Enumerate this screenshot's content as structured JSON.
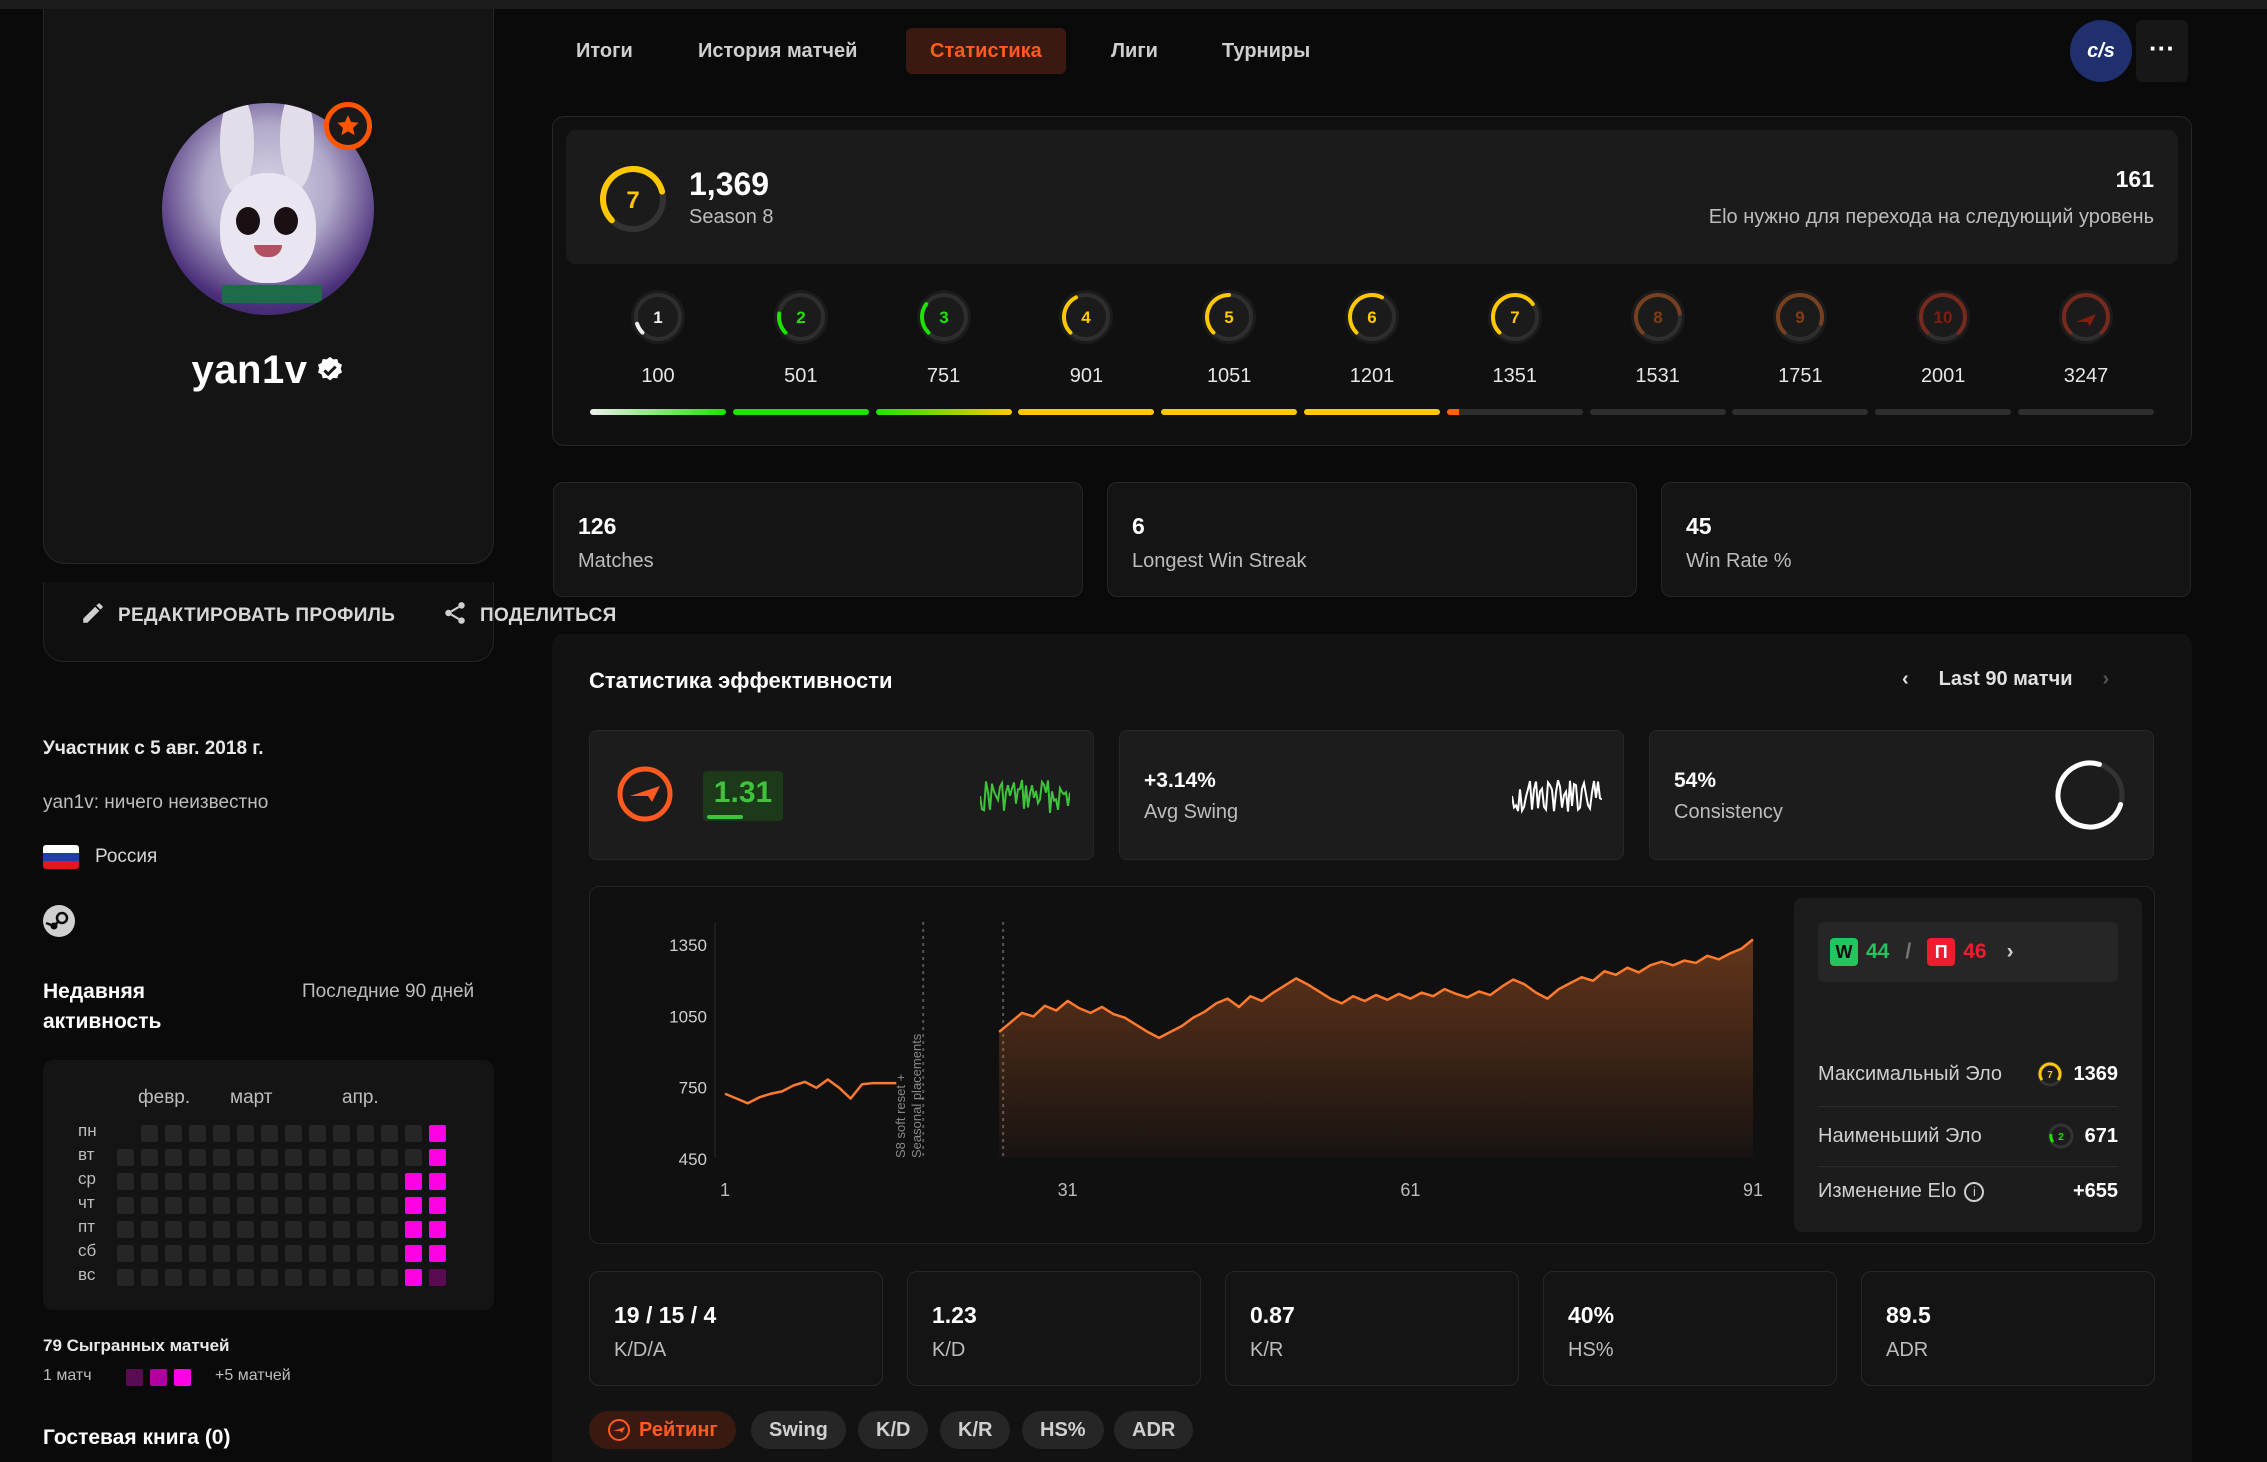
{
  "nav": {
    "tabs": [
      "Итоги",
      "История матчей",
      "Статистика",
      "Лиги",
      "Турниры"
    ],
    "active_tab": "Статистика",
    "game_logo": "cs",
    "more_label": "···"
  },
  "profile": {
    "username": "yan1v",
    "verified": true,
    "edit_label": "РЕДАКТИРОВАТЬ ПРОФИЛЬ",
    "share_label": "ПОДЕЛИТЬСЯ",
    "member_since": "Участник с 5 авг. 2018 г.",
    "bio": "yan1v: ничего неизвестно",
    "country": "Россия"
  },
  "activity": {
    "title": "Недавняя активность",
    "range": "Последние 90 дней",
    "months": [
      "февр.",
      "март",
      "апр."
    ],
    "days": [
      "пн",
      "вт",
      "ср",
      "чт",
      "пт",
      "сб",
      "вс"
    ],
    "active_cells": [
      [
        13,
        0
      ],
      [
        13,
        1
      ],
      [
        12,
        2
      ],
      [
        13,
        2
      ],
      [
        12,
        3
      ],
      [
        13,
        3
      ],
      [
        12,
        4
      ],
      [
        13,
        4
      ],
      [
        12,
        5
      ],
      [
        13,
        5
      ],
      [
        12,
        6
      ]
    ],
    "faint_cells": [
      [
        13,
        6
      ]
    ],
    "played_label": "79 Сыгранных матчей",
    "legend_low": "1 матч",
    "legend_high": "+5 матчей"
  },
  "guestbook": "Гостевая книга (0)",
  "elo": {
    "level": "7",
    "value": "1,369",
    "season": "Season 8",
    "to_next": "161",
    "to_next_label": "Elo нужно для перехода на следующий уровень",
    "progress_in_level": 0.09,
    "levels": [
      {
        "level": "1",
        "min": "100",
        "color": "#eeeeee"
      },
      {
        "level": "2",
        "min": "501",
        "color": "#1ce400"
      },
      {
        "level": "3",
        "min": "751",
        "color": "#1ce400"
      },
      {
        "level": "4",
        "min": "901",
        "color": "#ffc800"
      },
      {
        "level": "5",
        "min": "1051",
        "color": "#ffc800"
      },
      {
        "level": "6",
        "min": "1201",
        "color": "#ffc800"
      },
      {
        "level": "7",
        "min": "1351",
        "color": "#ffc800"
      },
      {
        "level": "8",
        "min": "1531",
        "color": "#ff6309"
      },
      {
        "level": "9",
        "min": "1751",
        "color": "#ff6309"
      },
      {
        "level": "10",
        "min": "2001",
        "color": "#fe1f00"
      },
      {
        "level": "",
        "min": "3247",
        "color": "#fe1f00"
      }
    ]
  },
  "stats": [
    {
      "value": "126",
      "label": "Matches"
    },
    {
      "value": "6",
      "label": "Longest Win Streak"
    },
    {
      "value": "45",
      "label": "Win Rate %"
    }
  ],
  "performance": {
    "title": "Статистика эффективности",
    "range": "Last 90 матчи",
    "rating": "1.31",
    "rating_fill": 0.5,
    "avg_swing": "+3.14%",
    "avg_swing_label": "Avg Swing",
    "consistency": "54%",
    "consistency_label": "Consistency",
    "consistency_fraction": 0.54,
    "wins": "44",
    "losses": "46",
    "win_letter": "W",
    "loss_letter": "П",
    "max_elo_label": "Максимальный Эло",
    "max_elo_level": "7",
    "max_elo": "1369",
    "min_elo_label": "Наименьший Эло",
    "min_elo_level": "2",
    "min_elo": "671",
    "elo_change_label": "Изменение Elo",
    "elo_change": "+655",
    "chart_annotation_1": "S8 soft reset +",
    "chart_annotation_2": "Seasonal placements"
  },
  "chart_data": {
    "type": "area",
    "title": "",
    "xlabel": "",
    "ylabel": "",
    "x_ticks": [
      1,
      31,
      61,
      91
    ],
    "y_ticks": [
      450,
      750,
      1050,
      1350
    ],
    "xlim": [
      1,
      91
    ],
    "ylim": [
      450,
      1400
    ],
    "series": [
      {
        "x": [
          1,
          2,
          3,
          4,
          5,
          6,
          7,
          8,
          9,
          10,
          11,
          12,
          13,
          14,
          15,
          16
        ],
        "y": [
          720,
          700,
          680,
          705,
          720,
          730,
          755,
          770,
          745,
          780,
          745,
          700,
          760,
          765,
          765,
          765
        ],
        "color": "#ff7a2e",
        "segment": "placement"
      },
      {
        "x": [
          25,
          26,
          27,
          28,
          29,
          30,
          31,
          32,
          33,
          34,
          35,
          36,
          37,
          38,
          39,
          40,
          41,
          42,
          43,
          44,
          45,
          46,
          47,
          48,
          49,
          50,
          51,
          52,
          53,
          54,
          55,
          56,
          57,
          58,
          59,
          60,
          61,
          62,
          63,
          64,
          65,
          66,
          67,
          68,
          69,
          70,
          71,
          72,
          73,
          74,
          75,
          76,
          77,
          78,
          79,
          80,
          81,
          82,
          83,
          84,
          85,
          86,
          87,
          88,
          89,
          90,
          91
        ],
        "y": [
          980,
          1020,
          1060,
          1045,
          1090,
          1070,
          1110,
          1080,
          1060,
          1085,
          1055,
          1040,
          1010,
          980,
          955,
          980,
          1005,
          1040,
          1065,
          1100,
          1120,
          1085,
          1130,
          1110,
          1145,
          1175,
          1205,
          1180,
          1150,
          1120,
          1100,
          1130,
          1110,
          1135,
          1115,
          1140,
          1120,
          1145,
          1130,
          1160,
          1140,
          1125,
          1150,
          1135,
          1170,
          1200,
          1180,
          1145,
          1120,
          1160,
          1185,
          1210,
          1195,
          1235,
          1220,
          1250,
          1230,
          1260,
          1275,
          1260,
          1280,
          1270,
          1300,
          1285,
          1310,
          1330,
          1369
        ],
        "color": "#ff7a2e",
        "segment": "season"
      }
    ],
    "grid": true
  },
  "bottom_stats": [
    {
      "value": "19 / 15 / 4",
      "label": "K/D/A"
    },
    {
      "value": "1.23",
      "label": "K/D"
    },
    {
      "value": "0.87",
      "label": "K/R"
    },
    {
      "value": "40%",
      "label": "HS%"
    },
    {
      "value": "89.5",
      "label": "ADR"
    }
  ],
  "chips": [
    "Рейтинг",
    "Swing",
    "K/D",
    "K/R",
    "HS%",
    "ADR"
  ],
  "colors": {
    "accent": "#ff5a1f",
    "win": "#22c55e",
    "loss": "#ef1b2f",
    "activity": "#ff00e6",
    "rating_green": "#3ec43a"
  },
  "icons": {
    "edit": "pencil-icon",
    "share": "share-icon",
    "steam": "steam-icon",
    "info": "info-icon"
  }
}
